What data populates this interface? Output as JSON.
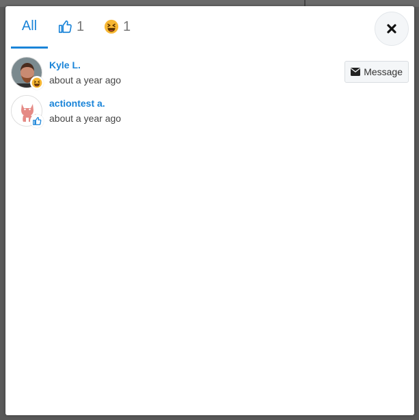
{
  "tabs": [
    {
      "label": "All"
    },
    {
      "icon": "thumbs-up-icon",
      "count": "1"
    },
    {
      "icon": "laughing-emoji-icon",
      "count": "1"
    }
  ],
  "users": [
    {
      "name": "Kyle L.",
      "time": "about a year ago",
      "reaction": "laughing-emoji-icon",
      "action": "Message"
    },
    {
      "name": "actiontest a.",
      "time": "about a year ago",
      "reaction": "thumbs-up-icon"
    }
  ],
  "colors": {
    "accent": "#1a84d8",
    "backdrop": "#595959"
  }
}
